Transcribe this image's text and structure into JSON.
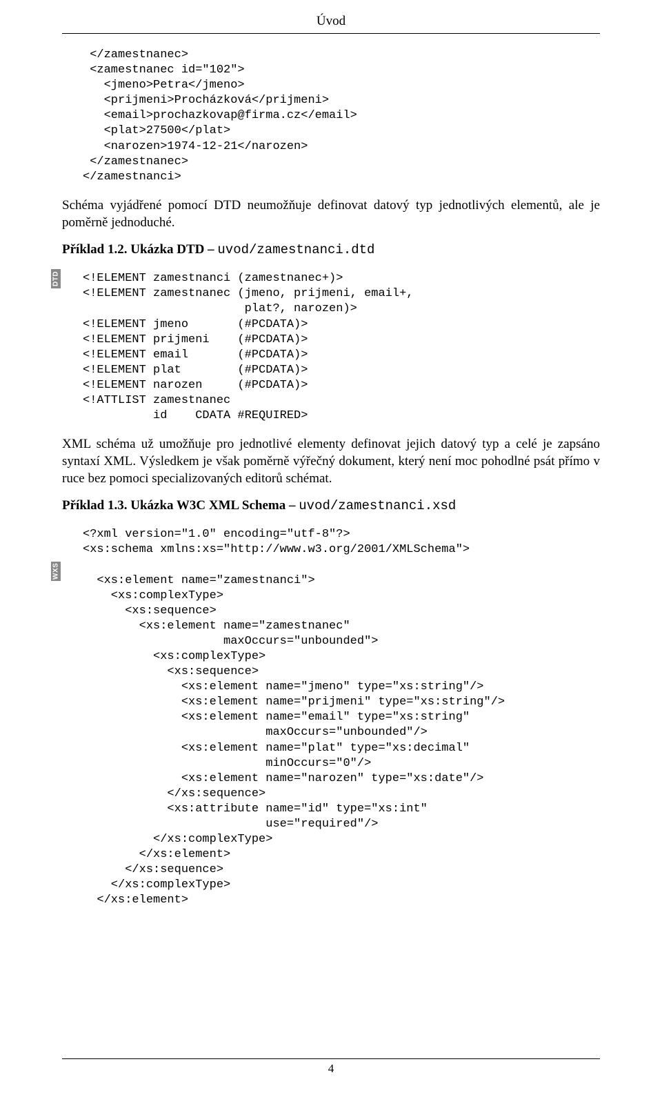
{
  "header": {
    "title": "Úvod"
  },
  "code1": " </zamestnanec>\n <zamestnanec id=\"102\">\n   <jmeno>Petra</jmeno>\n   <prijmeni>Procházková</prijmeni>\n   <email>prochazkovap@firma.cz</email>\n   <plat>27500</plat>\n   <narozen>1974-12-21</narozen>\n </zamestnanec>\n</zamestnanci>",
  "para1": "Schéma vyjádřené pomocí DTD neumožňuje definovat datový typ jednotlivých elementů, ale je poměrně jednoduché.",
  "example1": {
    "prefix": "Příklad 1.2. Ukázka DTD – ",
    "file": "uvod/zamestnanci.dtd"
  },
  "label_dtd": "DTD",
  "code2": "<!ELEMENT zamestnanci (zamestnanec+)>\n<!ELEMENT zamestnanec (jmeno, prijmeni, email+,\n                       plat?, narozen)>\n<!ELEMENT jmeno       (#PCDATA)>\n<!ELEMENT prijmeni    (#PCDATA)>\n<!ELEMENT email       (#PCDATA)>\n<!ELEMENT plat        (#PCDATA)>\n<!ELEMENT narozen     (#PCDATA)>\n<!ATTLIST zamestnanec\n          id    CDATA #REQUIRED>",
  "para2": "XML schéma už umožňuje pro jednotlivé elementy definovat jejich datový typ a celé je zapsáno syntaxí XML. Výsledkem je však poměrně výřečný dokument, který není moc pohodlné psát přímo v ruce bez pomoci specializovaných editorů schémat.",
  "example2": {
    "prefix": "Příklad 1.3. Ukázka W3C XML Schema – ",
    "file": "uvod/zamestnanci.xsd"
  },
  "label_wxs": "WXS",
  "code3": "<?xml version=\"1.0\" encoding=\"utf-8\"?>\n<xs:schema xmlns:xs=\"http://www.w3.org/2001/XMLSchema\">\n\n  <xs:element name=\"zamestnanci\">\n    <xs:complexType>\n      <xs:sequence>\n        <xs:element name=\"zamestnanec\"\n                    maxOccurs=\"unbounded\">\n          <xs:complexType>\n            <xs:sequence>\n              <xs:element name=\"jmeno\" type=\"xs:string\"/>\n              <xs:element name=\"prijmeni\" type=\"xs:string\"/>\n              <xs:element name=\"email\" type=\"xs:string\"\n                          maxOccurs=\"unbounded\"/>\n              <xs:element name=\"plat\" type=\"xs:decimal\"\n                          minOccurs=\"0\"/>\n              <xs:element name=\"narozen\" type=\"xs:date\"/>\n            </xs:sequence>\n            <xs:attribute name=\"id\" type=\"xs:int\"\n                          use=\"required\"/>\n          </xs:complexType>\n        </xs:element>\n      </xs:sequence>\n    </xs:complexType>\n  </xs:element>",
  "footer": {
    "page_number": "4"
  }
}
